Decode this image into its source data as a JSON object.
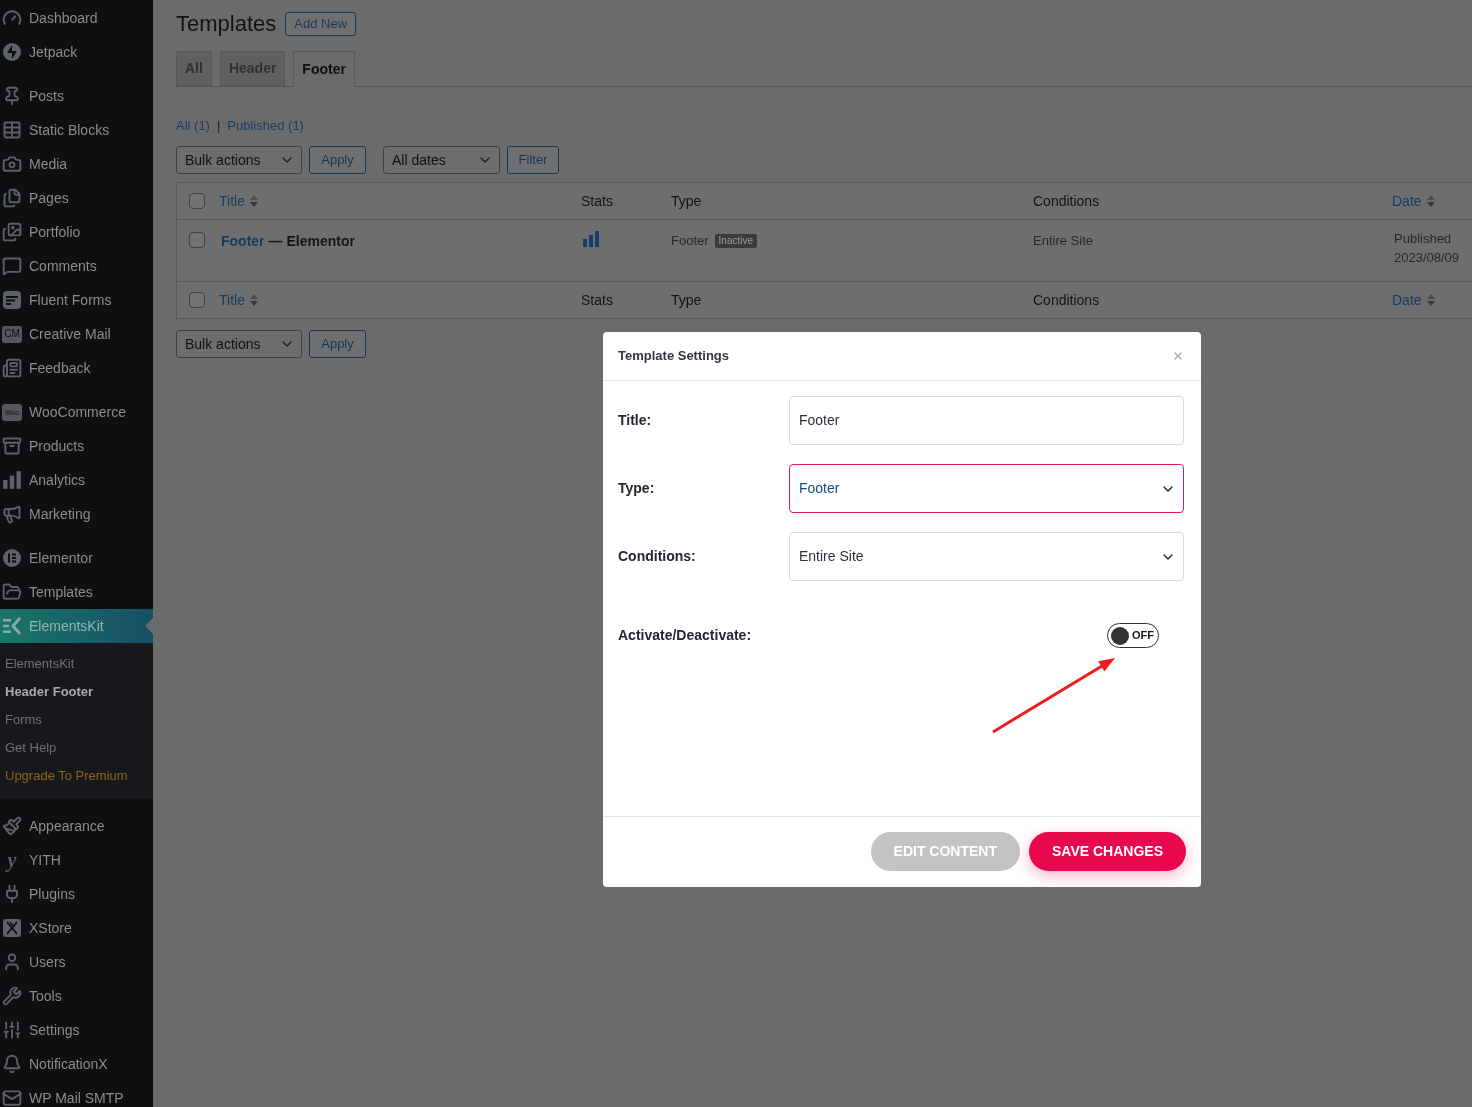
{
  "sidebar": {
    "sections": [
      {
        "items": [
          {
            "label": "Dashboard",
            "selected": false
          },
          {
            "label": "Jetpack",
            "selected": false
          }
        ]
      },
      {
        "items": [
          {
            "label": "Posts",
            "selected": false
          },
          {
            "label": "Static Blocks",
            "selected": false
          },
          {
            "label": "Media",
            "selected": false
          },
          {
            "label": "Pages",
            "selected": false
          },
          {
            "label": "Portfolio",
            "selected": false
          },
          {
            "label": "Comments",
            "selected": false
          },
          {
            "label": "Fluent Forms",
            "selected": false
          },
          {
            "label": "Creative Mail",
            "selected": false,
            "icon_text": "CM"
          },
          {
            "label": "Feedback",
            "selected": false
          }
        ]
      },
      {
        "items": [
          {
            "label": "WooCommerce",
            "selected": false,
            "icon_text": "Woo"
          },
          {
            "label": "Products",
            "selected": false
          },
          {
            "label": "Analytics",
            "selected": false
          },
          {
            "label": "Marketing",
            "selected": false
          }
        ]
      },
      {
        "items": [
          {
            "label": "Elementor",
            "selected": false
          },
          {
            "label": "Templates",
            "selected": false
          },
          {
            "label": "ElementsKit",
            "selected": true,
            "children": [
              {
                "label": "ElementsKit",
                "selected": false,
                "kind": "link"
              },
              {
                "label": "Header Footer",
                "selected": true,
                "kind": "link"
              },
              {
                "label": "Forms",
                "selected": false,
                "kind": "link"
              },
              {
                "label": "Get Help",
                "selected": false,
                "kind": "link"
              },
              {
                "label": "Upgrade To Premium",
                "selected": false,
                "kind": "promo"
              }
            ]
          }
        ]
      },
      {
        "items": [
          {
            "label": "Appearance",
            "selected": false
          },
          {
            "label": "YITH",
            "selected": false,
            "icon_text": "y"
          },
          {
            "label": "Plugins",
            "selected": false
          },
          {
            "label": "XStore",
            "selected": false
          },
          {
            "label": "Users",
            "selected": false
          },
          {
            "label": "Tools",
            "selected": false
          },
          {
            "label": "Settings",
            "selected": false
          },
          {
            "label": "NotificationX",
            "selected": false
          },
          {
            "label": "WP Mail SMTP",
            "selected": false
          }
        ]
      }
    ]
  },
  "page": {
    "title": "Templates",
    "add_new": "Add New"
  },
  "tabs": [
    {
      "label": "All",
      "selected": false
    },
    {
      "label": "Header",
      "selected": false
    },
    {
      "label": "Footer",
      "selected": true
    }
  ],
  "views": {
    "items": [
      {
        "label": "All (1)"
      },
      {
        "label": "Published (1)"
      }
    ],
    "separator": "|"
  },
  "tablenav_top": {
    "bulk_action": "Bulk actions",
    "apply": "Apply",
    "date_filter": "All dates",
    "filter": "Filter"
  },
  "table": {
    "header": {
      "checked": false,
      "columns": [
        {
          "label": "Title",
          "sortable": true
        },
        {
          "label": "Stats",
          "sortable": false
        },
        {
          "label": "Type",
          "sortable": false
        },
        {
          "label": "Conditions",
          "sortable": false
        },
        {
          "label": "Date",
          "sortable": true
        }
      ]
    },
    "rows": [
      {
        "checked": false,
        "title": "Footer",
        "title_suffix": "— Elementor",
        "type": "Footer",
        "status": "Inactive",
        "conditions": "Entire Site",
        "date_status": "Published",
        "date": "2023/08/09"
      }
    ],
    "footer": {
      "checked": false,
      "columns": [
        {
          "label": "Title",
          "sortable": true
        },
        {
          "label": "Stats",
          "sortable": false
        },
        {
          "label": "Type",
          "sortable": false
        },
        {
          "label": "Conditions",
          "sortable": false
        },
        {
          "label": "Date",
          "sortable": true
        }
      ]
    }
  },
  "tablenav_bottom": {
    "bulk_action": "Bulk actions",
    "apply": "Apply"
  },
  "modal": {
    "title": "Template Settings",
    "fields": [
      {
        "label": "Title:",
        "kind": "text",
        "value": "Footer",
        "focused": false
      },
      {
        "label": "Type:",
        "kind": "select",
        "value": "Footer",
        "focused": true
      },
      {
        "label": "Conditions:",
        "kind": "select",
        "value": "Entire Site",
        "focused": false
      }
    ],
    "toggle": {
      "label": "Activate/Deactivate:",
      "on": false,
      "text": "OFF"
    },
    "buttons": [
      {
        "label": "EDIT CONTENT",
        "kind": "secondary"
      },
      {
        "label": "SAVE CHANGES",
        "kind": "primary"
      }
    ]
  }
}
